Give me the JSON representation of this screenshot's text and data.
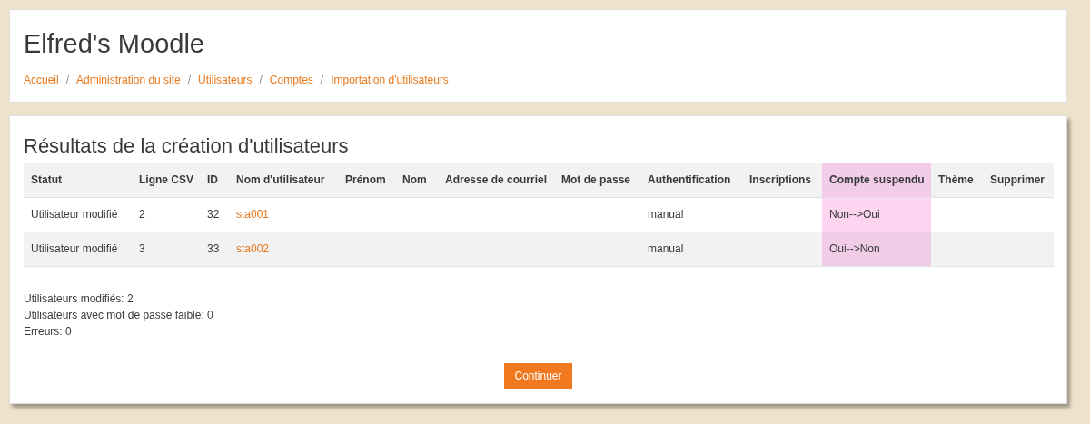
{
  "site_title": "Elfred's Moodle",
  "breadcrumb_separator": "/",
  "breadcrumb": [
    "Accueil",
    "Administration du site",
    "Utilisateurs",
    "Comptes",
    "Importation d'utilisateurs"
  ],
  "heading": "Résultats de la création d'utilisateurs",
  "table": {
    "columns": [
      {
        "label": "Statut",
        "highlighted": false
      },
      {
        "label": "Ligne CSV",
        "highlighted": false
      },
      {
        "label": "ID",
        "highlighted": false
      },
      {
        "label": "Nom d'utilisateur",
        "highlighted": false
      },
      {
        "label": "Prénom",
        "highlighted": false
      },
      {
        "label": "Nom",
        "highlighted": false
      },
      {
        "label": "Adresse de courriel",
        "highlighted": false
      },
      {
        "label": "Mot de passe",
        "highlighted": false
      },
      {
        "label": "Authentification",
        "highlighted": false
      },
      {
        "label": "Inscriptions",
        "highlighted": false
      },
      {
        "label": "Compte suspendu",
        "highlighted": true
      },
      {
        "label": "Thème",
        "highlighted": false
      },
      {
        "label": "Supprimer",
        "highlighted": false
      }
    ],
    "rows": [
      {
        "cells": [
          "Utilisateur modifié",
          "2",
          "32",
          "sta001",
          "",
          "",
          "",
          "",
          "manual",
          "",
          "Non-->Oui",
          "",
          ""
        ]
      },
      {
        "cells": [
          "Utilisateur modifié",
          "3",
          "33",
          "sta002",
          "",
          "",
          "",
          "",
          "manual",
          "",
          "Oui-->Non",
          "",
          ""
        ]
      }
    ]
  },
  "summary": [
    "Utilisateurs modifiés: 2",
    "Utilisateurs avec mot de passe faible: 0",
    "Erreurs: 0"
  ],
  "continue_button": "Continuer"
}
